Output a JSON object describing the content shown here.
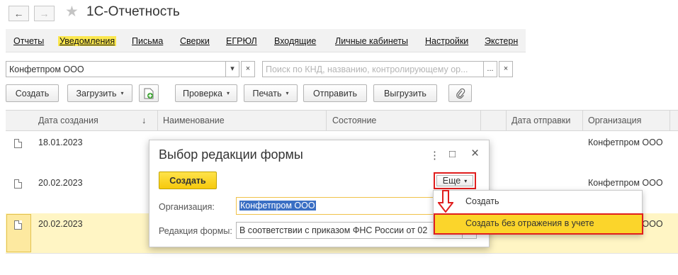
{
  "window": {
    "title": "1С-Отчетность",
    "back_glyph": "←",
    "forward_glyph": "→",
    "star_glyph": "★"
  },
  "tabs": [
    {
      "label": "Отчеты"
    },
    {
      "label": "Уведомления"
    },
    {
      "label": "Письма"
    },
    {
      "label": "Сверки"
    },
    {
      "label": "ЕГРЮЛ"
    },
    {
      "label": "Входящие"
    },
    {
      "label": "Личные кабинеты"
    },
    {
      "label": "Настройки"
    },
    {
      "label": "Экстерн"
    }
  ],
  "filters": {
    "organization_value": "Конфетпром ООО",
    "dropdown_glyph": "▾",
    "clear_glyph": "×",
    "more_glyph": "...",
    "search_placeholder": "Поиск по КНД, названию, контролирующему ор..."
  },
  "toolbar": {
    "create": "Создать",
    "load": "Загрузить",
    "check": "Проверка",
    "print": "Печать",
    "send": "Отправить",
    "unload": "Выгрузить",
    "caret": "▾"
  },
  "table": {
    "columns": {
      "date": "Дата создания",
      "sort_glyph": "↓",
      "name": "Наименование",
      "state": "Состояние",
      "send_date": "Дата отправки",
      "org": "Организация"
    },
    "rows": [
      {
        "date": "18.01.2023",
        "org": "Конфетпром ООО"
      },
      {
        "date": "20.02.2023",
        "org": "Конфетпром ООО"
      },
      {
        "date": "20.02.2023",
        "org": "Конфетпром ООО"
      }
    ]
  },
  "modal": {
    "title": "Выбор редакции формы",
    "more_glyph": "⋮",
    "maximize_glyph": "□",
    "close_glyph": "×",
    "create_button": "Создать",
    "more_button": "Еще",
    "org_label": "Организация:",
    "org_value": "Конфетпром ООО",
    "edition_label": "Редакция формы:",
    "edition_value": "В соответствии с приказом ФНС России от 02"
  },
  "menu": {
    "items": [
      {
        "label": "Создать"
      },
      {
        "label": "Создать без отражения в учете"
      }
    ]
  },
  "colors": {
    "accent_yellow": "#fbd52b",
    "highlight_red": "#e01e1e",
    "selected_row": "#fff5c4"
  }
}
